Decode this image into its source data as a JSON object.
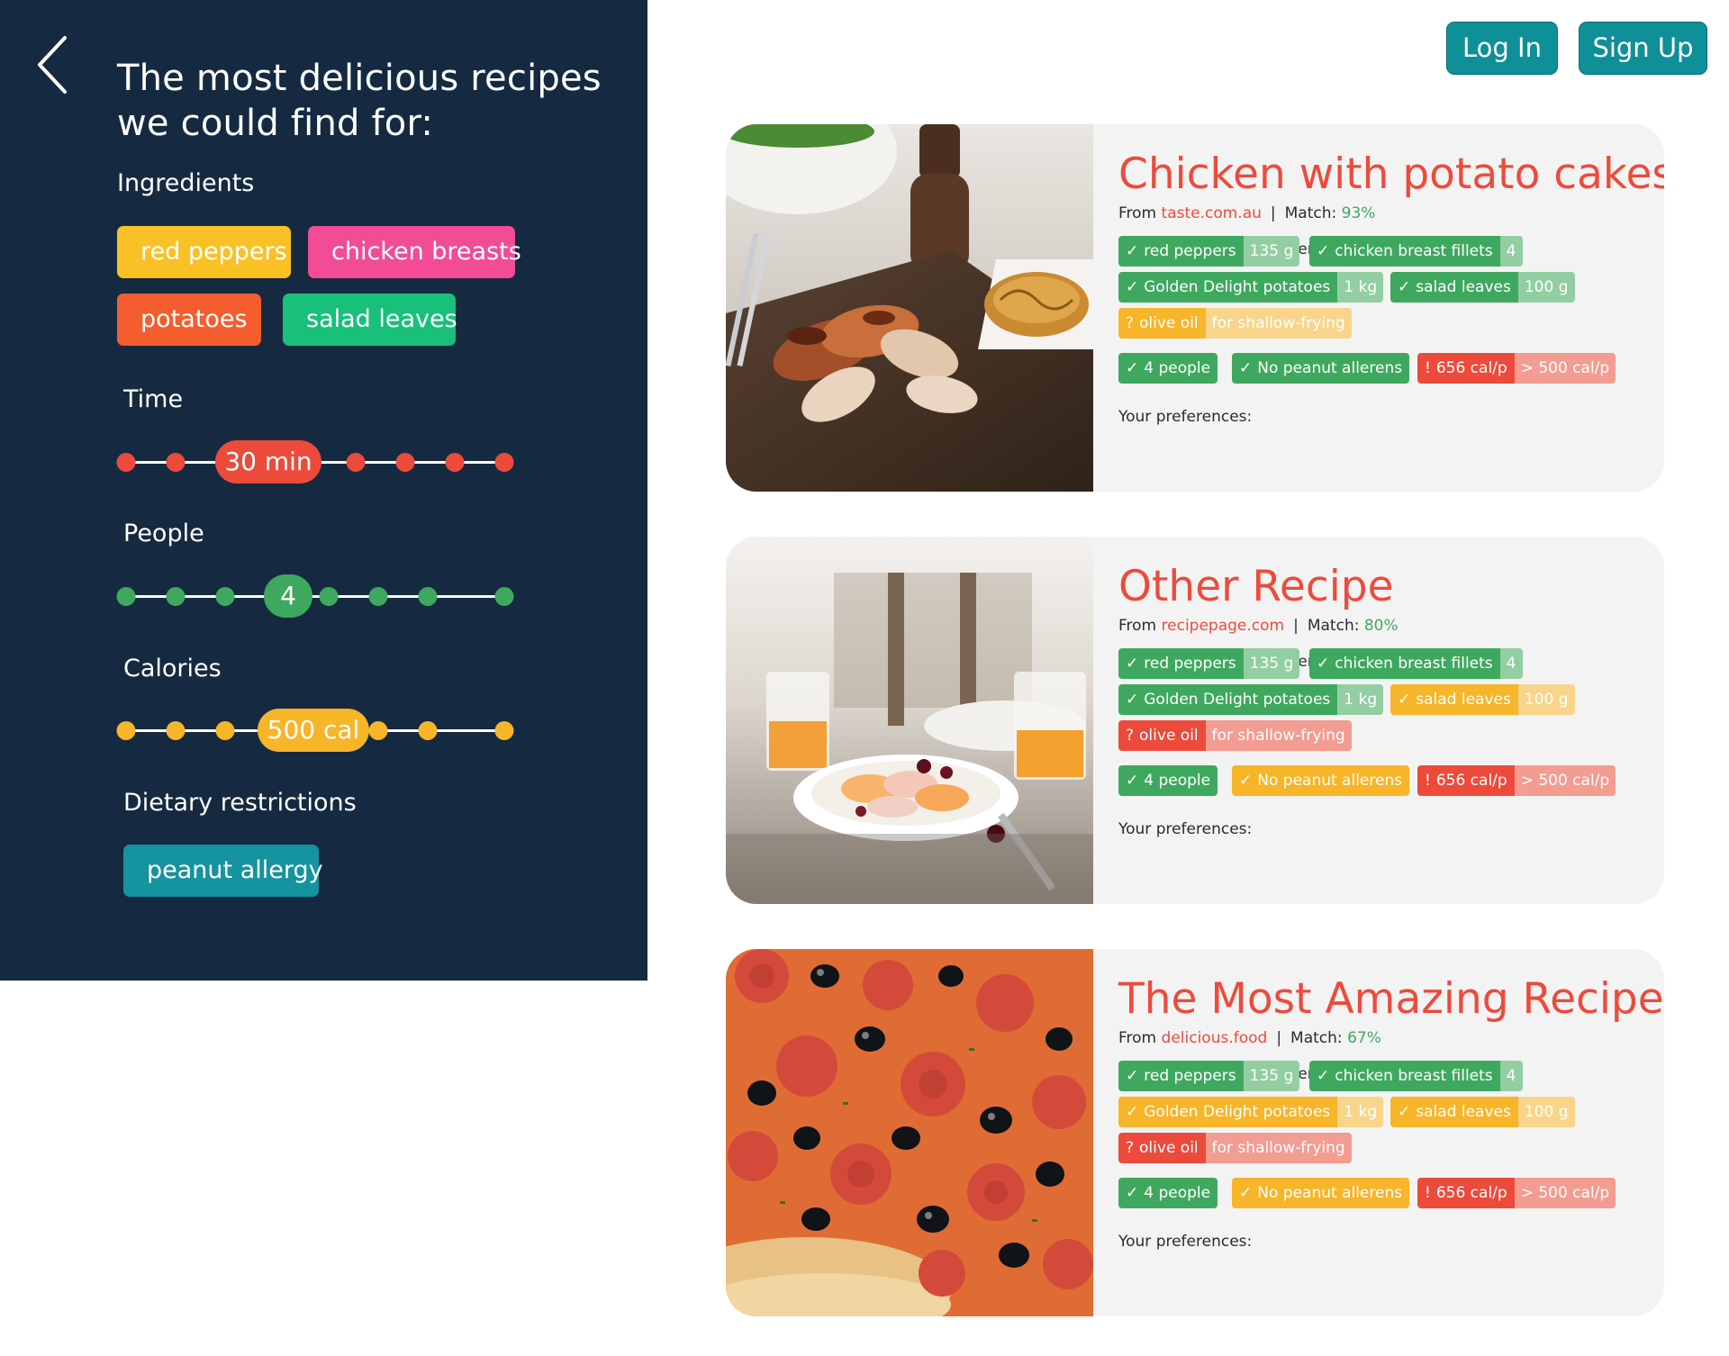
{
  "sidebar": {
    "title_line1": "The most delicious recipes",
    "title_line2": "we could find for:",
    "ingredients_label": "Ingredients",
    "ingredients": [
      {
        "label": "red peppers",
        "color": "#f9c125"
      },
      {
        "label": "chicken breasts",
        "color": "#f14c95"
      },
      {
        "label": "potatoes",
        "color": "#f45d2d"
      },
      {
        "label": "salad leaves",
        "color": "#18c07a"
      }
    ],
    "time": {
      "label": "Time",
      "value": "30 min",
      "color": "#ec4b3c",
      "selected_step": 3,
      "steps": 8
    },
    "people": {
      "label": "People",
      "value": "4",
      "color": "#3fa85f",
      "selected_step": 4,
      "steps": 8
    },
    "calories": {
      "label": "Calories",
      "value": "500 cal",
      "color": "#f7b52a",
      "selected_step": 4,
      "steps": 8
    },
    "dietary_label": "Dietary restrictions",
    "dietary": [
      {
        "label": "peanut allergy",
        "color": "#15939e"
      }
    ]
  },
  "header": {
    "login": "Log In",
    "signup": "Sign Up"
  },
  "recipes": [
    {
      "title": "Chicken with potato cakes",
      "from_label": "From",
      "source": "taste.com.au",
      "match_label": "Match:",
      "match": "93%",
      "note": "You have all the ingredients for this recipe!",
      "tags": [
        {
          "mark": "✓",
          "label": "red peppers",
          "extra": "135 g",
          "status": "g"
        },
        {
          "mark": "✓",
          "label": "chicken breast fillets",
          "extra": "4",
          "status": "g"
        },
        {
          "mark": "✓",
          "label": "Golden Delight potatoes",
          "extra": "1 kg",
          "status": "g"
        },
        {
          "mark": "✓",
          "label": "salad leaves",
          "extra": "100 g",
          "status": "g"
        },
        {
          "mark": "?",
          "label": "olive oil",
          "extra": "for shallow-frying",
          "status": "y"
        }
      ],
      "prefs_label": "Your preferences:",
      "prefs": [
        {
          "mark": "✓",
          "label": "4 people",
          "extra": "",
          "status": "g"
        },
        {
          "mark": "✓",
          "label": "No peanut allerens",
          "extra": "",
          "status": "g"
        },
        {
          "mark": "!",
          "label": "656 cal/p",
          "extra": "> 500 cal/p",
          "status": "r"
        }
      ],
      "photo": "chicken-potato-cakes-photo"
    },
    {
      "title": "Other Recipe",
      "from_label": "From",
      "source": "recipepage.com",
      "match_label": "Match:",
      "match": "80%",
      "note": "You have all the ingredients for this recipe!",
      "tags": [
        {
          "mark": "✓",
          "label": "red peppers",
          "extra": "135 g",
          "status": "g"
        },
        {
          "mark": "✓",
          "label": "chicken breast fillets",
          "extra": "4",
          "status": "g"
        },
        {
          "mark": "✓",
          "label": "Golden Delight potatoes",
          "extra": "1 kg",
          "status": "g"
        },
        {
          "mark": "✓",
          "label": "salad leaves",
          "extra": "100 g",
          "status": "y"
        },
        {
          "mark": "?",
          "label": "olive oil",
          "extra": "for shallow-frying",
          "status": "r"
        }
      ],
      "prefs_label": "Your preferences:",
      "prefs": [
        {
          "mark": "✓",
          "label": "4 people",
          "extra": "",
          "status": "g"
        },
        {
          "mark": "✓",
          "label": "No peanut allerens",
          "extra": "",
          "status": "y"
        },
        {
          "mark": "!",
          "label": "656 cal/p",
          "extra": "> 500 cal/p",
          "status": "r"
        }
      ],
      "photo": "breakfast-table-photo"
    },
    {
      "title": "The Most Amazing Recipe",
      "from_label": "From",
      "source": "delicious.food",
      "match_label": "Match:",
      "match": "67%",
      "note": "You have all the ingredients for this recipe!",
      "tags": [
        {
          "mark": "✓",
          "label": "red peppers",
          "extra": "135 g",
          "status": "g"
        },
        {
          "mark": "✓",
          "label": "chicken breast fillets",
          "extra": "4",
          "status": "g"
        },
        {
          "mark": "✓",
          "label": "Golden Delight potatoes",
          "extra": "1 kg",
          "status": "y"
        },
        {
          "mark": "✓",
          "label": "salad leaves",
          "extra": "100 g",
          "status": "y"
        },
        {
          "mark": "?",
          "label": "olive oil",
          "extra": "for shallow-frying",
          "status": "r"
        }
      ],
      "prefs_label": "Your preferences:",
      "prefs": [
        {
          "mark": "✓",
          "label": "4 people",
          "extra": "",
          "status": "g"
        },
        {
          "mark": "✓",
          "label": "No peanut allerens",
          "extra": "",
          "status": "y"
        },
        {
          "mark": "!",
          "label": "656 cal/p",
          "extra": "> 500 cal/p",
          "status": "r"
        }
      ],
      "photo": "pepperoni-pizza-photo"
    }
  ]
}
